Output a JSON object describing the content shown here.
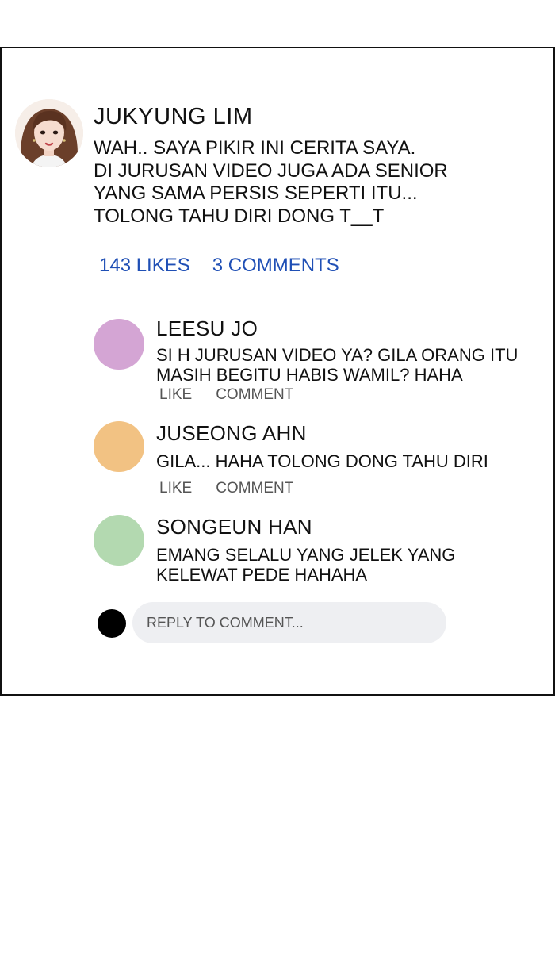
{
  "post": {
    "author": "JUKYUNG LIM",
    "lines": [
      "WAH.. SAYA PIKIR INI CERITA SAYA.",
      "DI JURUSAN VIDEO JUGA ADA SENIOR",
      "YANG SAMA PERSIS SEPERTI ITU...",
      "TOLONG TAHU DIRI DONG T__T"
    ],
    "likes": "143 LIKES",
    "comments_count": "3 COMMENTS"
  },
  "comments": [
    {
      "name": "LEESU JO",
      "avatar_color": "#d4a5d4",
      "lines": [
        "SI H JURUSAN VIDEO YA? GILA ORANG ITU",
        "MASIH BEGITU HABIS WAMIL? HAHA"
      ],
      "like_label": "LIKE",
      "comment_label": "COMMENT"
    },
    {
      "name": "JUSEONG AHN",
      "avatar_color": "#f2c283",
      "lines": [
        "GILA... HAHA TOLONG DONG TAHU DIRI"
      ],
      "like_label": "LIKE",
      "comment_label": "COMMENT"
    },
    {
      "name": "SONGEUN HAN",
      "avatar_color": "#b3d9b0",
      "lines": [
        "EMANG SELALU YANG JELEK YANG",
        "KELEWAT PEDE HAHAHA"
      ]
    }
  ],
  "reply": {
    "placeholder": "REPLY TO COMMENT..."
  },
  "icons": {
    "post_avatar": "woman-portrait-avatar",
    "reply_avatar": "black-dot-avatar"
  }
}
